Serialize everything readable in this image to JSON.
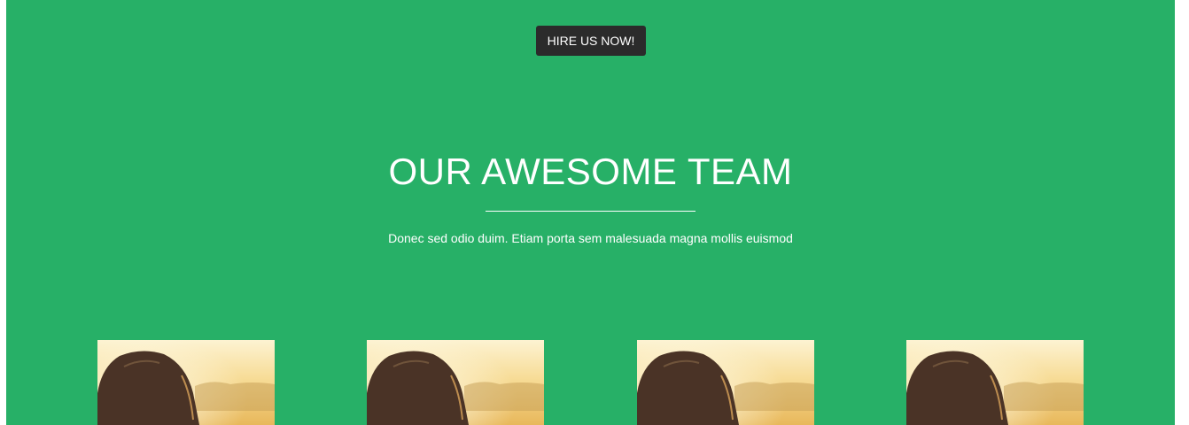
{
  "header": {
    "hire_button_label": "HIRE US NOW!"
  },
  "team": {
    "title": "OUR AWESOME TEAM",
    "subtitle": "Donec sed odio duim. Etiam porta sem malesuada magna mollis euismod"
  },
  "colors": {
    "background": "#27b067",
    "button": "#2b2b2b",
    "text": "#ffffff"
  }
}
